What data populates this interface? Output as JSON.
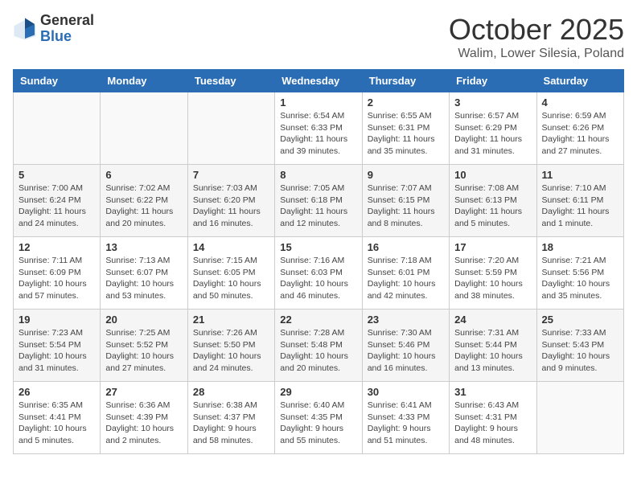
{
  "logo": {
    "general": "General",
    "blue": "Blue"
  },
  "title": {
    "month": "October 2025",
    "location": "Walim, Lower Silesia, Poland"
  },
  "headers": [
    "Sunday",
    "Monday",
    "Tuesday",
    "Wednesday",
    "Thursday",
    "Friday",
    "Saturday"
  ],
  "weeks": [
    [
      {
        "day": "",
        "info": ""
      },
      {
        "day": "",
        "info": ""
      },
      {
        "day": "",
        "info": ""
      },
      {
        "day": "1",
        "info": "Sunrise: 6:54 AM\nSunset: 6:33 PM\nDaylight: 11 hours\nand 39 minutes."
      },
      {
        "day": "2",
        "info": "Sunrise: 6:55 AM\nSunset: 6:31 PM\nDaylight: 11 hours\nand 35 minutes."
      },
      {
        "day": "3",
        "info": "Sunrise: 6:57 AM\nSunset: 6:29 PM\nDaylight: 11 hours\nand 31 minutes."
      },
      {
        "day": "4",
        "info": "Sunrise: 6:59 AM\nSunset: 6:26 PM\nDaylight: 11 hours\nand 27 minutes."
      }
    ],
    [
      {
        "day": "5",
        "info": "Sunrise: 7:00 AM\nSunset: 6:24 PM\nDaylight: 11 hours\nand 24 minutes."
      },
      {
        "day": "6",
        "info": "Sunrise: 7:02 AM\nSunset: 6:22 PM\nDaylight: 11 hours\nand 20 minutes."
      },
      {
        "day": "7",
        "info": "Sunrise: 7:03 AM\nSunset: 6:20 PM\nDaylight: 11 hours\nand 16 minutes."
      },
      {
        "day": "8",
        "info": "Sunrise: 7:05 AM\nSunset: 6:18 PM\nDaylight: 11 hours\nand 12 minutes."
      },
      {
        "day": "9",
        "info": "Sunrise: 7:07 AM\nSunset: 6:15 PM\nDaylight: 11 hours\nand 8 minutes."
      },
      {
        "day": "10",
        "info": "Sunrise: 7:08 AM\nSunset: 6:13 PM\nDaylight: 11 hours\nand 5 minutes."
      },
      {
        "day": "11",
        "info": "Sunrise: 7:10 AM\nSunset: 6:11 PM\nDaylight: 11 hours\nand 1 minute."
      }
    ],
    [
      {
        "day": "12",
        "info": "Sunrise: 7:11 AM\nSunset: 6:09 PM\nDaylight: 10 hours\nand 57 minutes."
      },
      {
        "day": "13",
        "info": "Sunrise: 7:13 AM\nSunset: 6:07 PM\nDaylight: 10 hours\nand 53 minutes."
      },
      {
        "day": "14",
        "info": "Sunrise: 7:15 AM\nSunset: 6:05 PM\nDaylight: 10 hours\nand 50 minutes."
      },
      {
        "day": "15",
        "info": "Sunrise: 7:16 AM\nSunset: 6:03 PM\nDaylight: 10 hours\nand 46 minutes."
      },
      {
        "day": "16",
        "info": "Sunrise: 7:18 AM\nSunset: 6:01 PM\nDaylight: 10 hours\nand 42 minutes."
      },
      {
        "day": "17",
        "info": "Sunrise: 7:20 AM\nSunset: 5:59 PM\nDaylight: 10 hours\nand 38 minutes."
      },
      {
        "day": "18",
        "info": "Sunrise: 7:21 AM\nSunset: 5:56 PM\nDaylight: 10 hours\nand 35 minutes."
      }
    ],
    [
      {
        "day": "19",
        "info": "Sunrise: 7:23 AM\nSunset: 5:54 PM\nDaylight: 10 hours\nand 31 minutes."
      },
      {
        "day": "20",
        "info": "Sunrise: 7:25 AM\nSunset: 5:52 PM\nDaylight: 10 hours\nand 27 minutes."
      },
      {
        "day": "21",
        "info": "Sunrise: 7:26 AM\nSunset: 5:50 PM\nDaylight: 10 hours\nand 24 minutes."
      },
      {
        "day": "22",
        "info": "Sunrise: 7:28 AM\nSunset: 5:48 PM\nDaylight: 10 hours\nand 20 minutes."
      },
      {
        "day": "23",
        "info": "Sunrise: 7:30 AM\nSunset: 5:46 PM\nDaylight: 10 hours\nand 16 minutes."
      },
      {
        "day": "24",
        "info": "Sunrise: 7:31 AM\nSunset: 5:44 PM\nDaylight: 10 hours\nand 13 minutes."
      },
      {
        "day": "25",
        "info": "Sunrise: 7:33 AM\nSunset: 5:43 PM\nDaylight: 10 hours\nand 9 minutes."
      }
    ],
    [
      {
        "day": "26",
        "info": "Sunrise: 6:35 AM\nSunset: 4:41 PM\nDaylight: 10 hours\nand 5 minutes."
      },
      {
        "day": "27",
        "info": "Sunrise: 6:36 AM\nSunset: 4:39 PM\nDaylight: 10 hours\nand 2 minutes."
      },
      {
        "day": "28",
        "info": "Sunrise: 6:38 AM\nSunset: 4:37 PM\nDaylight: 9 hours\nand 58 minutes."
      },
      {
        "day": "29",
        "info": "Sunrise: 6:40 AM\nSunset: 4:35 PM\nDaylight: 9 hours\nand 55 minutes."
      },
      {
        "day": "30",
        "info": "Sunrise: 6:41 AM\nSunset: 4:33 PM\nDaylight: 9 hours\nand 51 minutes."
      },
      {
        "day": "31",
        "info": "Sunrise: 6:43 AM\nSunset: 4:31 PM\nDaylight: 9 hours\nand 48 minutes."
      },
      {
        "day": "",
        "info": ""
      }
    ]
  ]
}
